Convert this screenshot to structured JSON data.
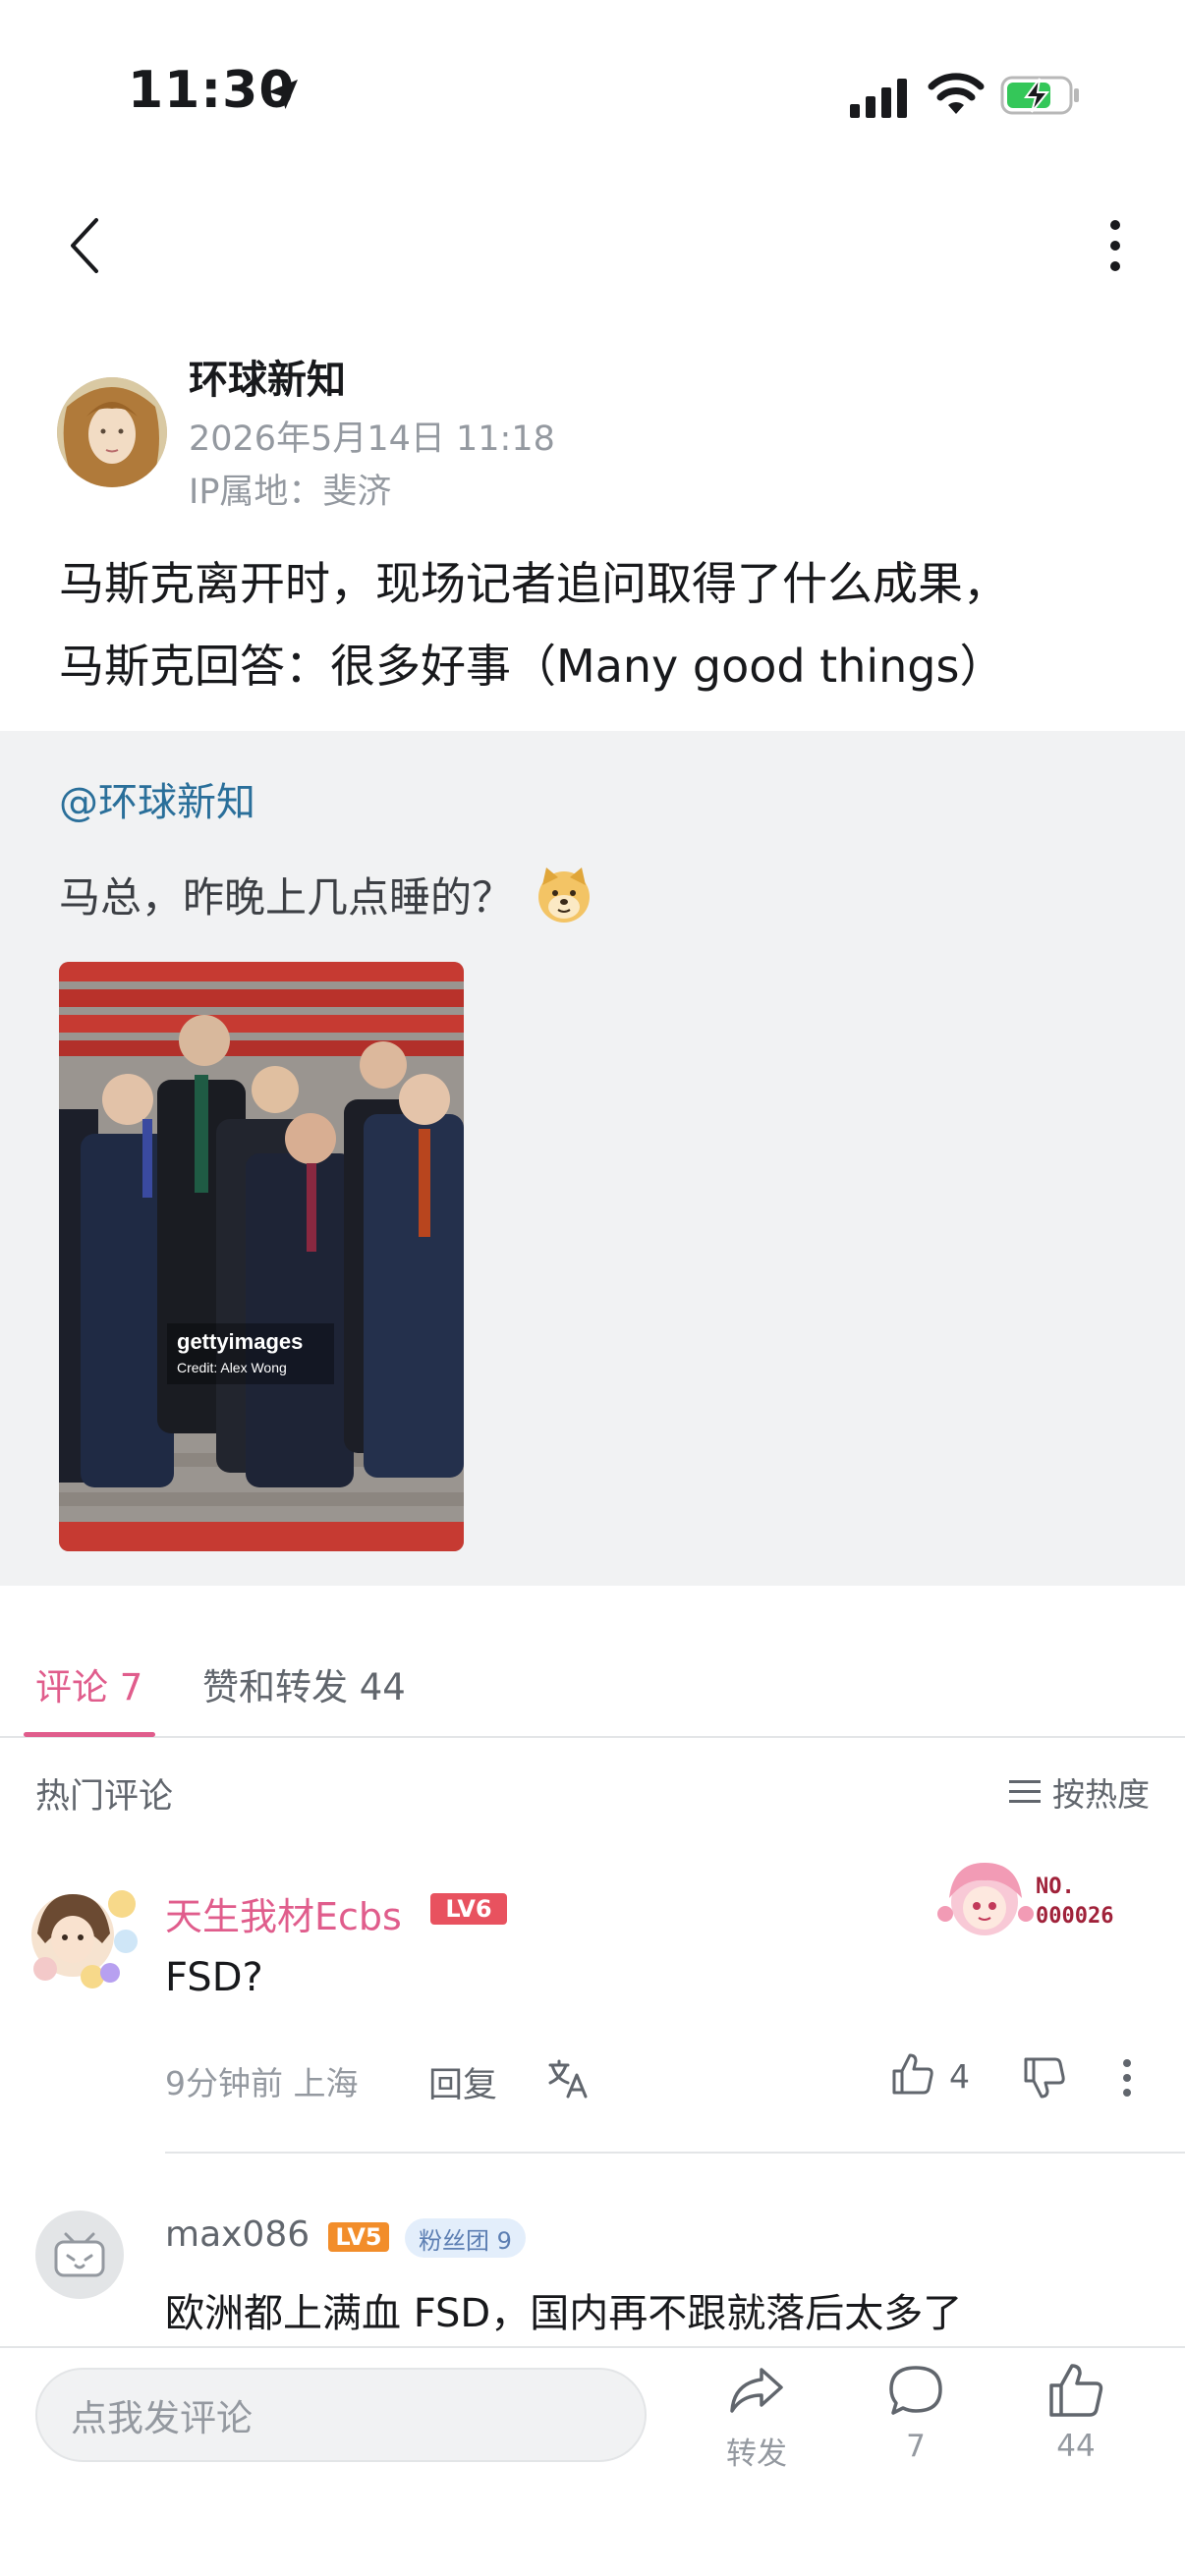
{
  "status_bar": {
    "time": "11:30"
  },
  "post": {
    "author": "环球新知",
    "date": "2026年5月14日 11:18",
    "ip": "IP属地：斐济",
    "text_line1": "马斯克离开时，现场记者追问取得了什么成果，",
    "text_line2": "马斯克回答：很多好事（Many good things）"
  },
  "quote": {
    "author": "@环球新知",
    "text": "马总，昨晚上几点睡的？",
    "image_watermark": "gettyimages",
    "image_credit": "Credit: Alex Wong"
  },
  "tabs": {
    "comments": "评论 7",
    "likes_reposts": "赞和转发 44"
  },
  "comments_header": {
    "title": "热门评论",
    "sort_label": "按热度"
  },
  "comments": [
    {
      "user": "天生我材Ecbs",
      "level": "LV6",
      "text": "FSD?",
      "time_location": "9分钟前 上海",
      "reply_label": "回复",
      "likes": "4",
      "sticker_no_label": "NO.",
      "sticker_no_value": "000026"
    },
    {
      "user": "max086",
      "level": "LV5",
      "fan_badge": "粉丝团 9",
      "text": "欧洲都上满血 FSD，国内再不跟就落后太多了"
    }
  ],
  "bottom_bar": {
    "input_placeholder": "点我发评论",
    "share_label": "转发",
    "comment_count": "7",
    "like_count": "44"
  },
  "colors": {
    "accent_pink": "#e05d8c",
    "link_blue": "#2a6f9a",
    "quote_bg": "#f1f2f3",
    "battery_green": "#34c759"
  }
}
